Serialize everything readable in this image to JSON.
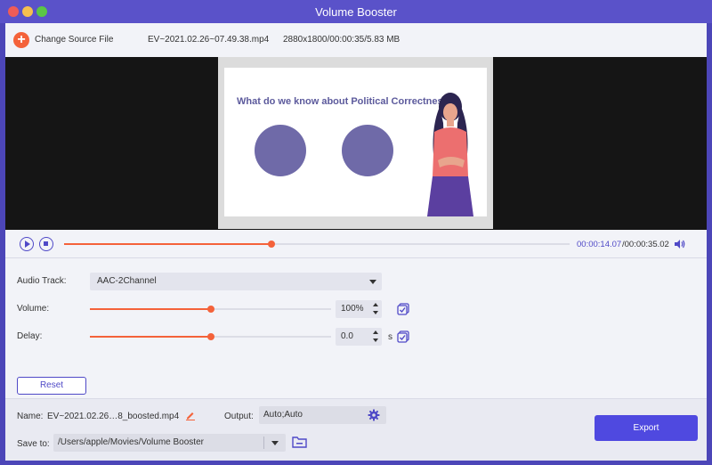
{
  "window": {
    "title": "Volume Booster"
  },
  "source": {
    "change_label": "Change Source File",
    "file_name": "EV~2021.02.26~07.49.38.mp4",
    "file_info": "2880x1800/00:00:35/5.83 MB"
  },
  "preview": {
    "slide_title": "What do we know about Political Correctness?"
  },
  "player": {
    "current_time": "00:00:14.07",
    "total_time": "/00:00:35.02",
    "progress_fraction": 0.41
  },
  "settings": {
    "audio_track_label": "Audio Track:",
    "audio_track_value": "AAC-2Channel",
    "volume_label": "Volume:",
    "volume_value": "100%",
    "volume_fraction": 0.5,
    "delay_label": "Delay:",
    "delay_value": "0.0",
    "delay_unit": "s",
    "delay_fraction": 0.5,
    "reset_label": "Reset"
  },
  "output": {
    "name_label": "Name:",
    "name_value": "EV~2021.02.26…8_boosted.mp4",
    "output_label": "Output:",
    "output_value": "Auto;Auto",
    "save_label": "Save to:",
    "save_path": "/Users/apple/Movies/Volume Booster",
    "export_label": "Export"
  },
  "colors": {
    "accent": "#4f49c7",
    "orange": "#f4623a",
    "titlebar": "#5a52c9"
  }
}
